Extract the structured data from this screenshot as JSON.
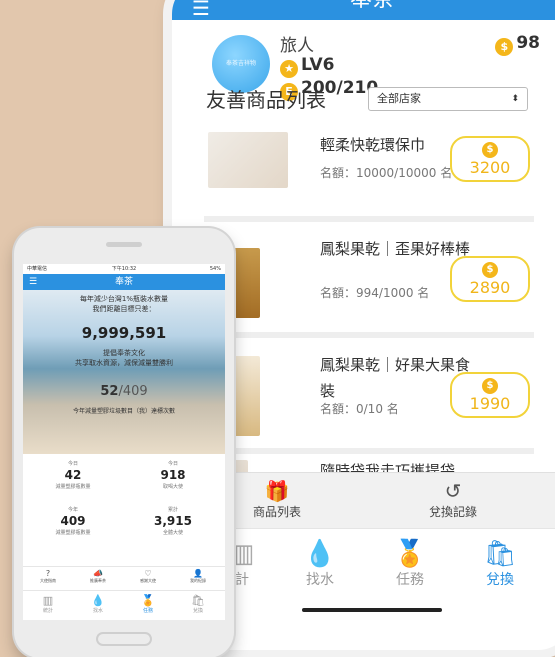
{
  "big": {
    "header_title": "奉茶",
    "profile": {
      "avatar_text": "奉茶吉祥物",
      "name": "旅人",
      "level": "LV6",
      "exp": "200/210",
      "coins": "98"
    },
    "list_title": "友善商品列表",
    "store_select": "全部店家",
    "products": [
      {
        "name": "輕柔快乾環保巾",
        "quota": "名額：10000/10000 名",
        "price": "3200"
      },
      {
        "name": "鳳梨果乾｜歪果好棒棒",
        "quota": "名額：994/1000 名",
        "price": "2890"
      },
      {
        "name": "鳳梨果乾｜好果大果食裝",
        "quota": "名額：0/10 名",
        "price": "1990"
      },
      {
        "name": "隨時袋我走巧攜提袋",
        "quota": "",
        "price": ""
      }
    ],
    "subtabs": [
      {
        "label": "商品列表",
        "icon": "gift-icon"
      },
      {
        "label": "兌換記錄",
        "icon": "history-icon"
      }
    ],
    "nav": [
      {
        "label": "計",
        "icon": "chart-icon"
      },
      {
        "label": "找水",
        "icon": "water-drop-icon"
      },
      {
        "label": "任務",
        "icon": "medal-icon"
      },
      {
        "label": "兌換",
        "icon": "redeem-icon",
        "active": true
      }
    ]
  },
  "small": {
    "status_left": "中華電信",
    "status_time": "下午10:32",
    "status_right": "54%",
    "header_title": "奉茶",
    "hero": {
      "line1": "每年減少台灣1%瓶裝水數量",
      "line2": "我們距離目標只差：",
      "bottles": "9,999,591",
      "line3": "提倡奉茶文化",
      "line4": "共享取水資源，減保減量雙勝利",
      "progress_done": "52",
      "progress_total": "/409",
      "line5": "今年減量塑膠垃圾數目（我）達標次數"
    },
    "stats": [
      {
        "caption": "今日",
        "value": "42",
        "sub": "減量塑膠瓶數量"
      },
      {
        "caption": "今日",
        "value": "918",
        "sub": "取喝大使"
      },
      {
        "caption": "今年",
        "value": "409",
        "sub": "減量塑膠瓶數量"
      },
      {
        "caption": "累計",
        "value": "3,915",
        "sub": "全體大使"
      }
    ],
    "actions": [
      {
        "label": "大使指南",
        "icon": "help-icon"
      },
      {
        "label": "推廣奉茶",
        "icon": "megaphone-icon"
      },
      {
        "label": "感謝大使",
        "icon": "heart-icon"
      },
      {
        "label": "我的紀錄",
        "icon": "person-icon"
      }
    ],
    "nav": [
      {
        "label": "統計",
        "icon": "chart-icon"
      },
      {
        "label": "找水",
        "icon": "water-drop-icon"
      },
      {
        "label": "任務",
        "icon": "medal-icon",
        "active": true
      },
      {
        "label": "兌換",
        "icon": "redeem-icon"
      }
    ]
  },
  "colors": {
    "primary": "#2b91e0",
    "coin": "#f4b61a",
    "redeem_border": "#f2d33a",
    "background": "#e2c7ad"
  }
}
